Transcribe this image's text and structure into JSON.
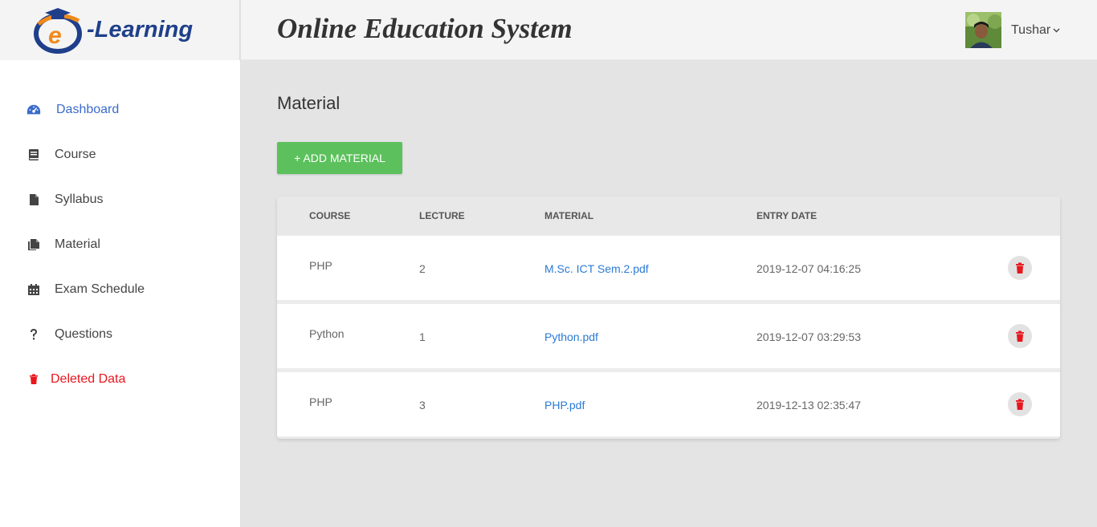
{
  "brand": {
    "logo_text": "-Learning",
    "logo_letter": "e"
  },
  "header": {
    "title": "Online Education System",
    "user_name": "Tushar",
    "chevron": "⌄"
  },
  "sidebar": {
    "items": [
      {
        "label": "Dashboard",
        "icon": "dashboard-icon"
      },
      {
        "label": "Course",
        "icon": "book-icon"
      },
      {
        "label": "Syllabus",
        "icon": "file-icon"
      },
      {
        "label": "Material",
        "icon": "files-icon"
      },
      {
        "label": "Exam Schedule",
        "icon": "calendar-icon"
      },
      {
        "label": "Questions",
        "icon": "question-icon"
      },
      {
        "label": "Deleted Data",
        "icon": "trash-icon"
      }
    ],
    "active_color": "#3a6bcc",
    "danger_color": "#e8161d"
  },
  "main": {
    "title": "Material",
    "add_button": "+ ADD MATERIAL",
    "columns": [
      "COURSE",
      "LECTURE",
      "MATERIAL",
      "ENTRY DATE"
    ],
    "rows": [
      {
        "course": "PHP",
        "lecture": "2",
        "material": "M.Sc. ICT Sem.2.pdf",
        "entry_date": "2019-12-07 04:16:25"
      },
      {
        "course": "Python",
        "lecture": "1",
        "material": "Python.pdf",
        "entry_date": "2019-12-07 03:29:53"
      },
      {
        "course": "PHP",
        "lecture": "3",
        "material": "PHP.pdf",
        "entry_date": "2019-12-13 02:35:47"
      }
    ],
    "button_color": "#5cc15c",
    "link_color": "#2b7ad6",
    "delete_color": "#e8161d"
  }
}
